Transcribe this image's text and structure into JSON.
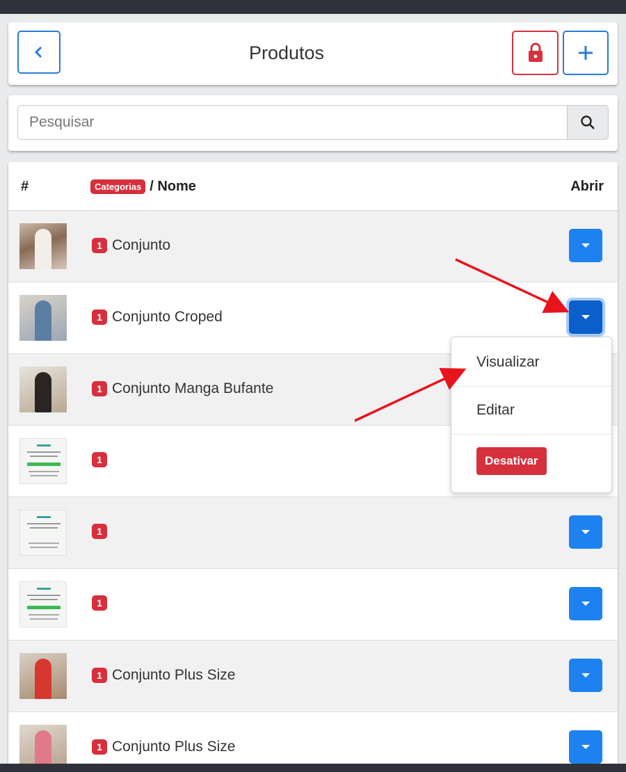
{
  "header": {
    "title": "Produtos",
    "back_icon": "chevron-left-icon",
    "lock_icon": "lock-icon",
    "add_icon": "plus-icon"
  },
  "search": {
    "placeholder": "Pesquisar",
    "icon": "search-icon"
  },
  "table": {
    "columns": {
      "hash": "#",
      "category_badge": "Categorias",
      "name_suffix": "/ Nome",
      "open": "Abrir"
    },
    "rows": [
      {
        "count": "1",
        "name": "Conjunto",
        "thumb": "photo"
      },
      {
        "count": "1",
        "name": "Conjunto Croped",
        "thumb": "photo"
      },
      {
        "count": "1",
        "name": "Conjunto Manga Bufante",
        "thumb": "photo"
      },
      {
        "count": "1",
        "name": "",
        "thumb": "document"
      },
      {
        "count": "1",
        "name": "",
        "thumb": "document"
      },
      {
        "count": "1",
        "name": "",
        "thumb": "document"
      },
      {
        "count": "1",
        "name": "Conjunto Plus Size",
        "thumb": "photo"
      },
      {
        "count": "1",
        "name": "Conjunto Plus Size",
        "thumb": "photo"
      }
    ]
  },
  "dropdown": {
    "view_label": "Visualizar",
    "edit_label": "Editar",
    "deactivate_label": "Desativar"
  },
  "colors": {
    "primary": "#1d82f0",
    "danger": "#d62f3e",
    "annotation_arrow": "#e8141c"
  }
}
